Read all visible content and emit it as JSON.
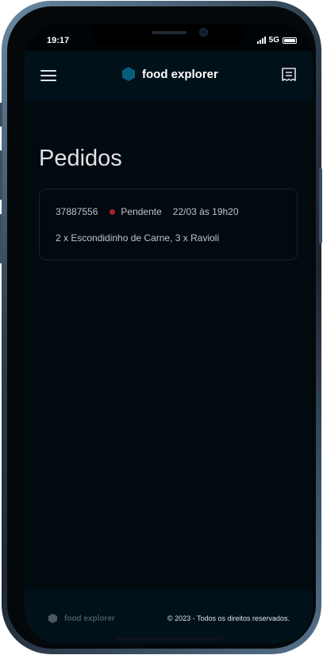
{
  "status_bar": {
    "time": "19:17",
    "network": "5G"
  },
  "header": {
    "brand": "food explorer"
  },
  "main": {
    "title": "Pedidos",
    "orders": [
      {
        "id": "37887556",
        "status": "Pendente",
        "status_color": "#AB222E",
        "date": "22/03 às 19h20",
        "items": "2 x Escondidinho de Carne, 3 x Ravioli"
      }
    ]
  },
  "footer": {
    "brand": "food explorer",
    "copyright": "© 2023 - Todos os direitos reservados."
  },
  "colors": {
    "accent": "#065E7C",
    "header_bg": "#00111A",
    "page_bg": "#000A0F"
  },
  "icons": [
    "menu-icon",
    "logo-hex-icon",
    "receipt-icon",
    "footer-logo-icon"
  ]
}
